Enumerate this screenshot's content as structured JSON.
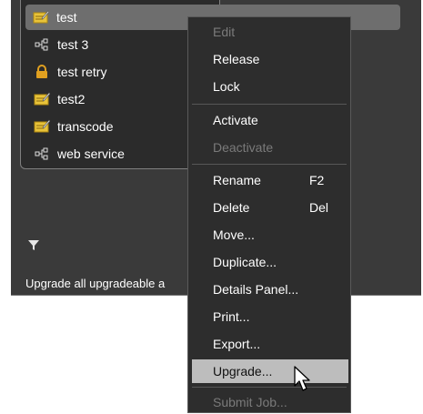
{
  "list": {
    "items": [
      {
        "label": "test",
        "icon": "edit-note-icon",
        "selected": true
      },
      {
        "label": "test 3",
        "icon": "workflow-icon",
        "selected": false
      },
      {
        "label": "test retry",
        "icon": "lock-icon",
        "selected": false
      },
      {
        "label": "test2",
        "icon": "edit-note-icon",
        "selected": false
      },
      {
        "label": "transcode",
        "icon": "edit-note-icon",
        "selected": false
      },
      {
        "label": "web service",
        "icon": "workflow-icon",
        "selected": false
      }
    ]
  },
  "status": {
    "text": "Upgrade all upgradeable a"
  },
  "context_menu": {
    "items": [
      {
        "label": "Edit",
        "shortcut": "",
        "enabled": false
      },
      {
        "label": "Release",
        "shortcut": "",
        "enabled": true
      },
      {
        "label": "Lock",
        "shortcut": "",
        "enabled": true
      },
      {
        "label": "Activate",
        "shortcut": "",
        "enabled": true
      },
      {
        "label": "Deactivate",
        "shortcut": "",
        "enabled": false
      },
      {
        "label": "Rename",
        "shortcut": "F2",
        "enabled": true
      },
      {
        "label": "Delete",
        "shortcut": "Del",
        "enabled": true
      },
      {
        "label": "Move...",
        "shortcut": "",
        "enabled": true
      },
      {
        "label": "Duplicate...",
        "shortcut": "",
        "enabled": true
      },
      {
        "label": "Details Panel...",
        "shortcut": "",
        "enabled": true
      },
      {
        "label": "Print...",
        "shortcut": "",
        "enabled": true
      },
      {
        "label": "Export...",
        "shortcut": "",
        "enabled": true
      },
      {
        "label": "Upgrade...",
        "shortcut": "",
        "enabled": true,
        "highlighted": true
      },
      {
        "label": "Submit Job...",
        "shortcut": "",
        "enabled": false
      }
    ]
  },
  "colors": {
    "panel": "#3a3a3a",
    "list_bg": "#2b2b2b",
    "selected_row": "#6e6e6e",
    "menu_bg": "#2d2d2d",
    "menu_highlight": "#bdbdbd",
    "disabled_text": "#7a7a7a",
    "note_icon": "#e8c33a",
    "lock_icon": "#e0a020"
  }
}
